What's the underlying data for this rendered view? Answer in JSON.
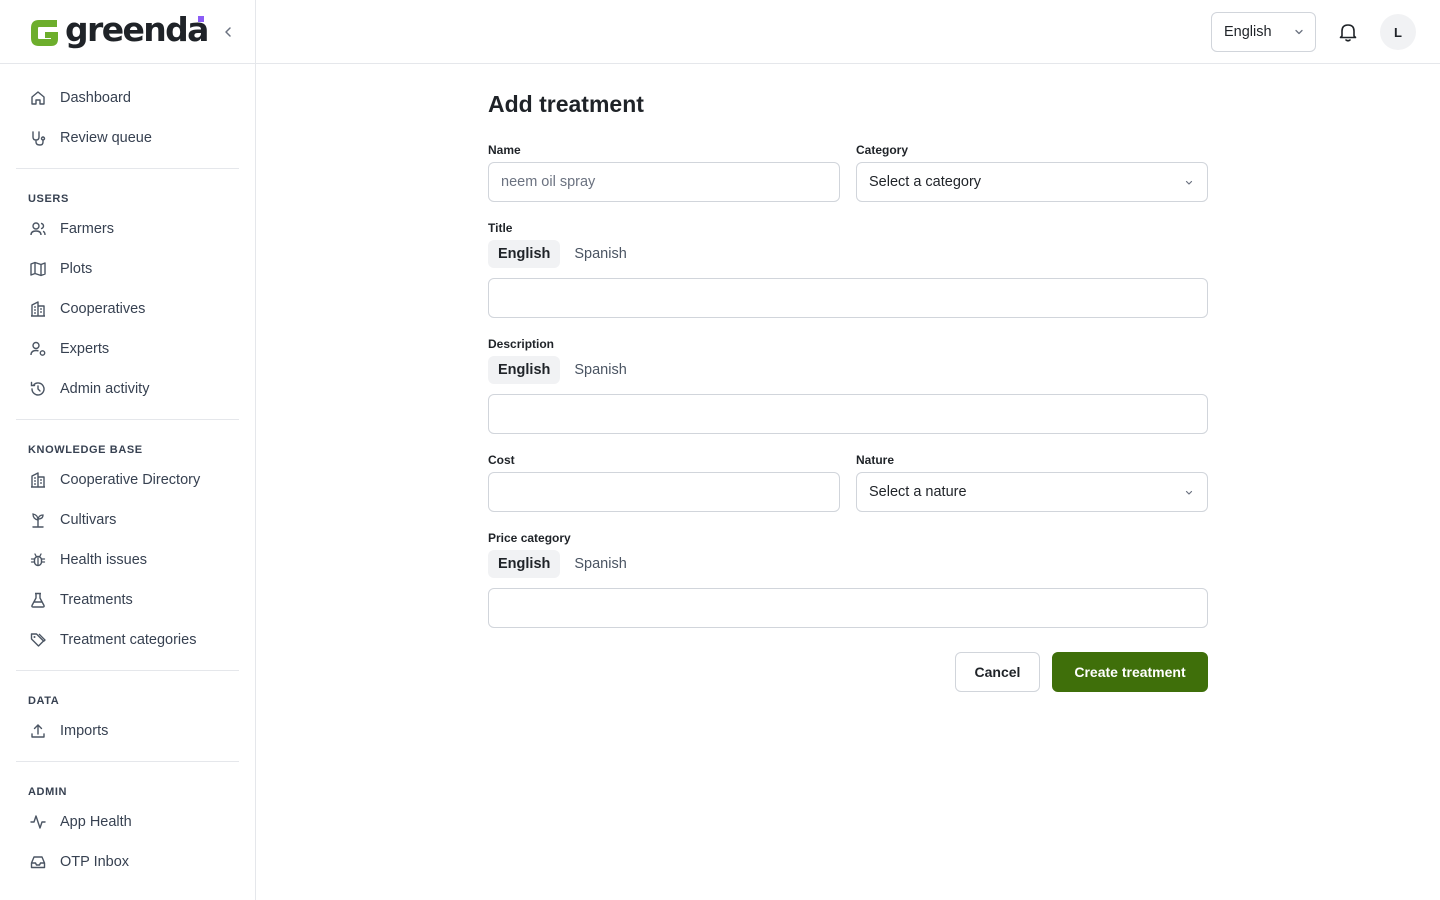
{
  "brand": {
    "name": "greenda",
    "accent": "#6dae2c",
    "dot_color": "#8b5cf6"
  },
  "header": {
    "language": "English",
    "avatar_initial": "L"
  },
  "sidebar": {
    "primary": [
      {
        "label": "Dashboard",
        "icon": "home-icon"
      },
      {
        "label": "Review queue",
        "icon": "stethoscope-icon"
      }
    ],
    "users_title": "USERS",
    "users": [
      {
        "label": "Farmers",
        "icon": "users-icon"
      },
      {
        "label": "Plots",
        "icon": "map-icon"
      },
      {
        "label": "Cooperatives",
        "icon": "building-icon"
      },
      {
        "label": "Experts",
        "icon": "user-cog-icon"
      },
      {
        "label": "Admin activity",
        "icon": "history-icon"
      }
    ],
    "kb_title": "KNOWLEDGE BASE",
    "kb": [
      {
        "label": "Cooperative Directory",
        "icon": "building-icon"
      },
      {
        "label": "Cultivars",
        "icon": "sprout-icon"
      },
      {
        "label": "Health issues",
        "icon": "bug-icon"
      },
      {
        "label": "Treatments",
        "icon": "flask-icon"
      },
      {
        "label": "Treatment categories",
        "icon": "tags-icon"
      }
    ],
    "data_title": "DATA",
    "data": [
      {
        "label": "Imports",
        "icon": "upload-icon"
      }
    ],
    "admin_title": "ADMIN",
    "admin": [
      {
        "label": "App Health",
        "icon": "activity-icon"
      },
      {
        "label": "OTP Inbox",
        "icon": "inbox-icon"
      }
    ]
  },
  "form": {
    "title": "Add treatment",
    "name_label": "Name",
    "name_placeholder": "neem oil spray",
    "category_label": "Category",
    "category_value": "Select a category",
    "title_label": "Title",
    "description_label": "Description",
    "cost_label": "Cost",
    "nature_label": "Nature",
    "nature_value": "Select a nature",
    "price_category_label": "Price category",
    "tab_english": "English",
    "tab_spanish": "Spanish",
    "cancel_label": "Cancel",
    "create_label": "Create treatment"
  },
  "colors": {
    "primary_button": "#3f6f0a",
    "border": "#d1d5db"
  }
}
